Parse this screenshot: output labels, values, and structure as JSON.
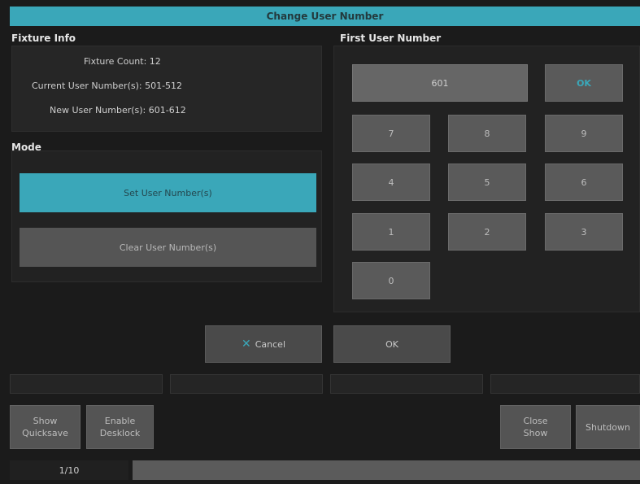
{
  "dialog": {
    "title": "Change User Number"
  },
  "fixture_info": {
    "heading": "Fixture Info",
    "fixture_count": "Fixture Count: 12",
    "current_numbers": "Current User Number(s): 501-512",
    "new_numbers": "New User Number(s): 601-612"
  },
  "mode": {
    "heading": "Mode",
    "set_label": "Set User Number(s)",
    "clear_label": "Clear User Number(s)"
  },
  "keypad": {
    "heading": "First User Number",
    "entry_value": "601",
    "ok_label": "OK",
    "keys": [
      "7",
      "8",
      "9",
      "4",
      "5",
      "6",
      "1",
      "2",
      "3",
      "0"
    ]
  },
  "actions": {
    "cancel_label": "Cancel",
    "ok_label": "OK"
  },
  "bottom_bar": {
    "show_quicksave": [
      "Show",
      "Quicksave"
    ],
    "enable_desklock": [
      "Enable",
      "Desklock"
    ],
    "close_show": [
      "Close",
      "Show"
    ],
    "shutdown": "Shutdown"
  },
  "status": {
    "page": "1/10"
  },
  "colors": {
    "accent": "#3aa7b9",
    "background": "#1b1b1b"
  }
}
